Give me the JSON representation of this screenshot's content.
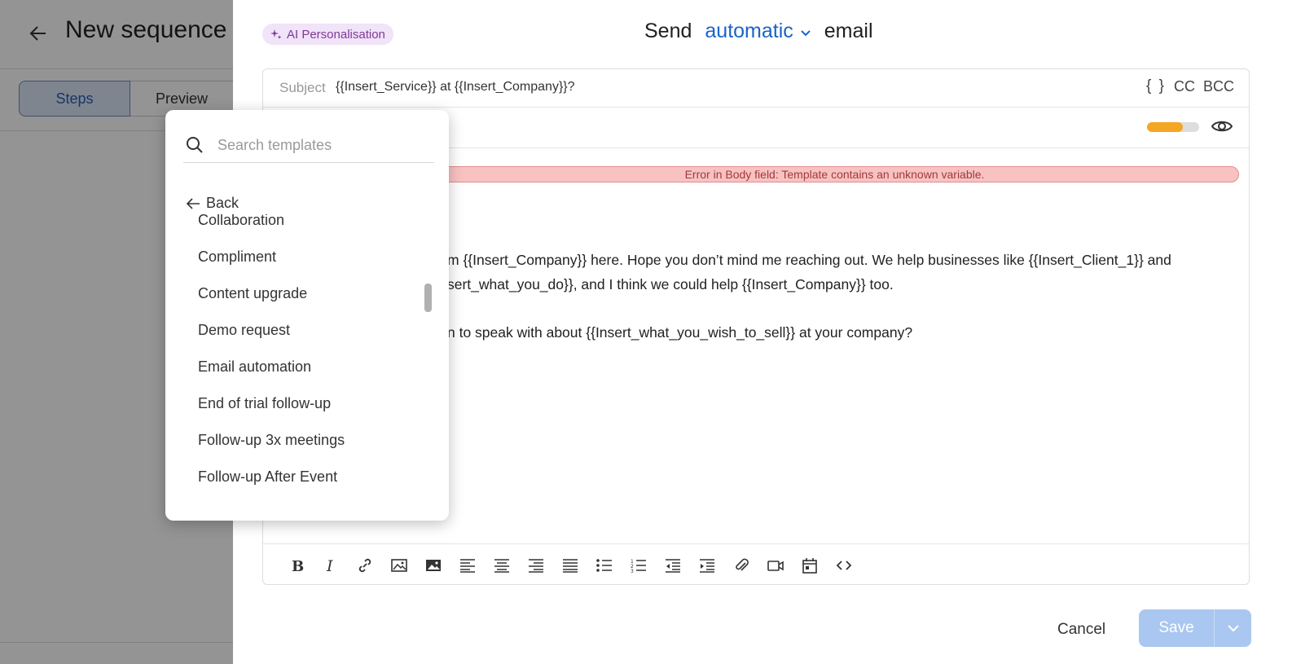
{
  "background": {
    "title": "New sequence",
    "tabs": [
      {
        "label": "Steps"
      },
      {
        "label": "Preview"
      }
    ]
  },
  "composer": {
    "ai_chip_label": "AI Personalisation",
    "send_word": "Send",
    "send_mode": "automatic",
    "email_word": "email",
    "subject_label": "Subject",
    "subject_value": "{{Insert_Service}} at {{Insert_Company}}?",
    "braces_label": "{ }",
    "cc_label": "CC",
    "bcc_label": "BCC",
    "progress": 0.68,
    "error_message": "Error in Body field: Template contains an unknown variable.",
    "body_lines": [
      "m {{Insert_Company}} here. Hope you don’t mind me reaching out. We help businesses like {{Insert_Client_1}} and",
      "sert_what_you_do}}, and I think we could help {{Insert_Company}} too.",
      "n to speak with about {{Insert_what_you_wish_to_sell}} at your company?"
    ],
    "cancel_label": "Cancel",
    "save_label": "Save"
  },
  "templates_dropdown": {
    "search_placeholder": "Search templates",
    "back_label": "Back",
    "items": [
      {
        "label": "Collaboration"
      },
      {
        "label": "Compliment"
      },
      {
        "label": "Content upgrade"
      },
      {
        "label": "Demo request"
      },
      {
        "label": "Email automation"
      },
      {
        "label": "End of trial follow-up"
      },
      {
        "label": "Follow-up 3x meetings"
      },
      {
        "label": "Follow-up After Event"
      }
    ]
  },
  "colors": {
    "accent": "#1a63c8",
    "error_bg": "#f9c2c2",
    "progress": "#f5a623",
    "save_bg": "#a9c7f0",
    "ai_chip_bg": "#f1e3f8"
  },
  "icons": [
    "back-arrow-icon",
    "sparkle-icon",
    "chevron-down-icon",
    "eye-icon",
    "search-icon",
    "arrow-left-icon",
    "bold-icon",
    "italic-icon",
    "link-icon",
    "image-icon",
    "image-filled-icon",
    "align-left-icon",
    "align-center-icon",
    "align-right-icon",
    "align-justify-icon",
    "bullet-list-icon",
    "numbered-list-icon",
    "outdent-icon",
    "indent-icon",
    "attachment-icon",
    "video-icon",
    "calendar-icon",
    "code-icon"
  ]
}
